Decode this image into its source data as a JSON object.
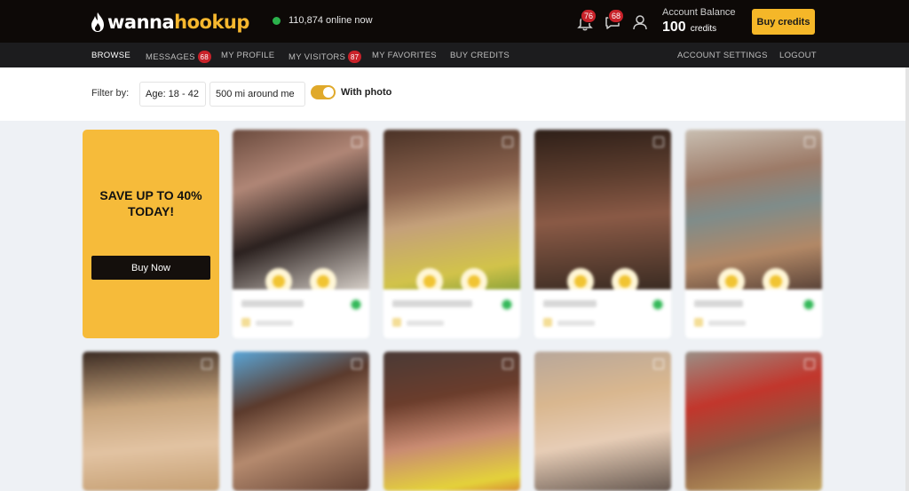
{
  "brand": {
    "logo_part1": "wanna",
    "logo_part2": "hookup",
    "accent": "#f5b728"
  },
  "header": {
    "online_count": "110,874 online now",
    "notifications_badge": "76",
    "messages_badge": "68",
    "balance_label": "Account Balance",
    "balance_amount": "100",
    "balance_unit": "credits",
    "buy_credits_label": "Buy credits"
  },
  "nav": {
    "browse": "BROWSE",
    "messages": "MESSAGES",
    "messages_badge": "68",
    "my_profile": "MY PROFILE",
    "my_visitors": "MY VISITORS",
    "visitors_badge": "87",
    "my_favorites": "MY FAVORITES",
    "buy_credits": "BUY CREDITS",
    "account_settings": "ACCOUNT SETTINGS",
    "logout": "LOGOUT"
  },
  "filters": {
    "label": "Filter by:",
    "age": "Age: 18 - 42",
    "distance": "500 mi around me",
    "with_photo": "With photo",
    "with_photo_on": true
  },
  "promo": {
    "title_line1": "SAVE UP TO 40%",
    "title_line2": "TODAY!",
    "button_label": "Buy Now"
  },
  "profiles_row1_count": 4,
  "profiles_row2_count": 5
}
